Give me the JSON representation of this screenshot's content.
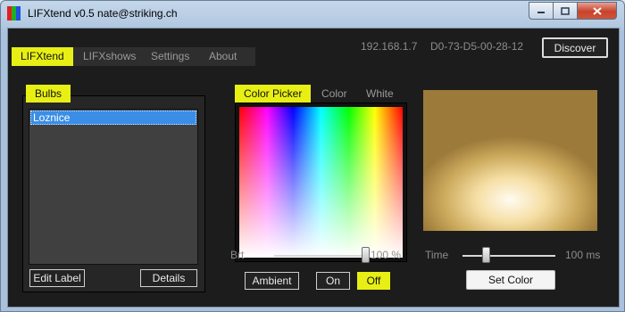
{
  "window": {
    "title": "LIFXtend v0.5  nate@striking.ch",
    "icon": "app-icon",
    "controls": [
      "minimize-icon",
      "maximize-icon",
      "close-icon"
    ]
  },
  "header": {
    "tabs": [
      {
        "label": "LIFXtend",
        "active": true
      },
      {
        "label": "LIFXshows",
        "active": false
      },
      {
        "label": "Settings",
        "active": false
      },
      {
        "label": "About",
        "active": false
      }
    ],
    "ip_address": "192.168.1.7",
    "mac_address": "D0-73-D5-00-28-12",
    "discover_label": "Discover"
  },
  "bulbs": {
    "title": "Bulbs",
    "items": [
      {
        "label": "Loznice",
        "selected": true
      }
    ],
    "edit_label": "Edit Label",
    "details_label": "Details"
  },
  "color": {
    "tabs": [
      {
        "label": "Color Picker",
        "active": true
      },
      {
        "label": "Color",
        "active": false
      },
      {
        "label": "White",
        "active": false
      }
    ],
    "brightness_label": "Brt",
    "brightness_value_text": "100 %",
    "brightness_level": 1.0,
    "ambient_label": "Ambient",
    "on_label": "On",
    "off_label": "Off",
    "power_state": "Off"
  },
  "preview": {
    "time_label": "Time",
    "time_value_text": "100 ms",
    "time_level": 0.25,
    "set_color_label": "Set Color"
  },
  "colors": {
    "accent": "#e8ef14",
    "background": "#1c1c1c",
    "selection": "#3a8ee6",
    "preview_warm": "#f6dfa6"
  }
}
